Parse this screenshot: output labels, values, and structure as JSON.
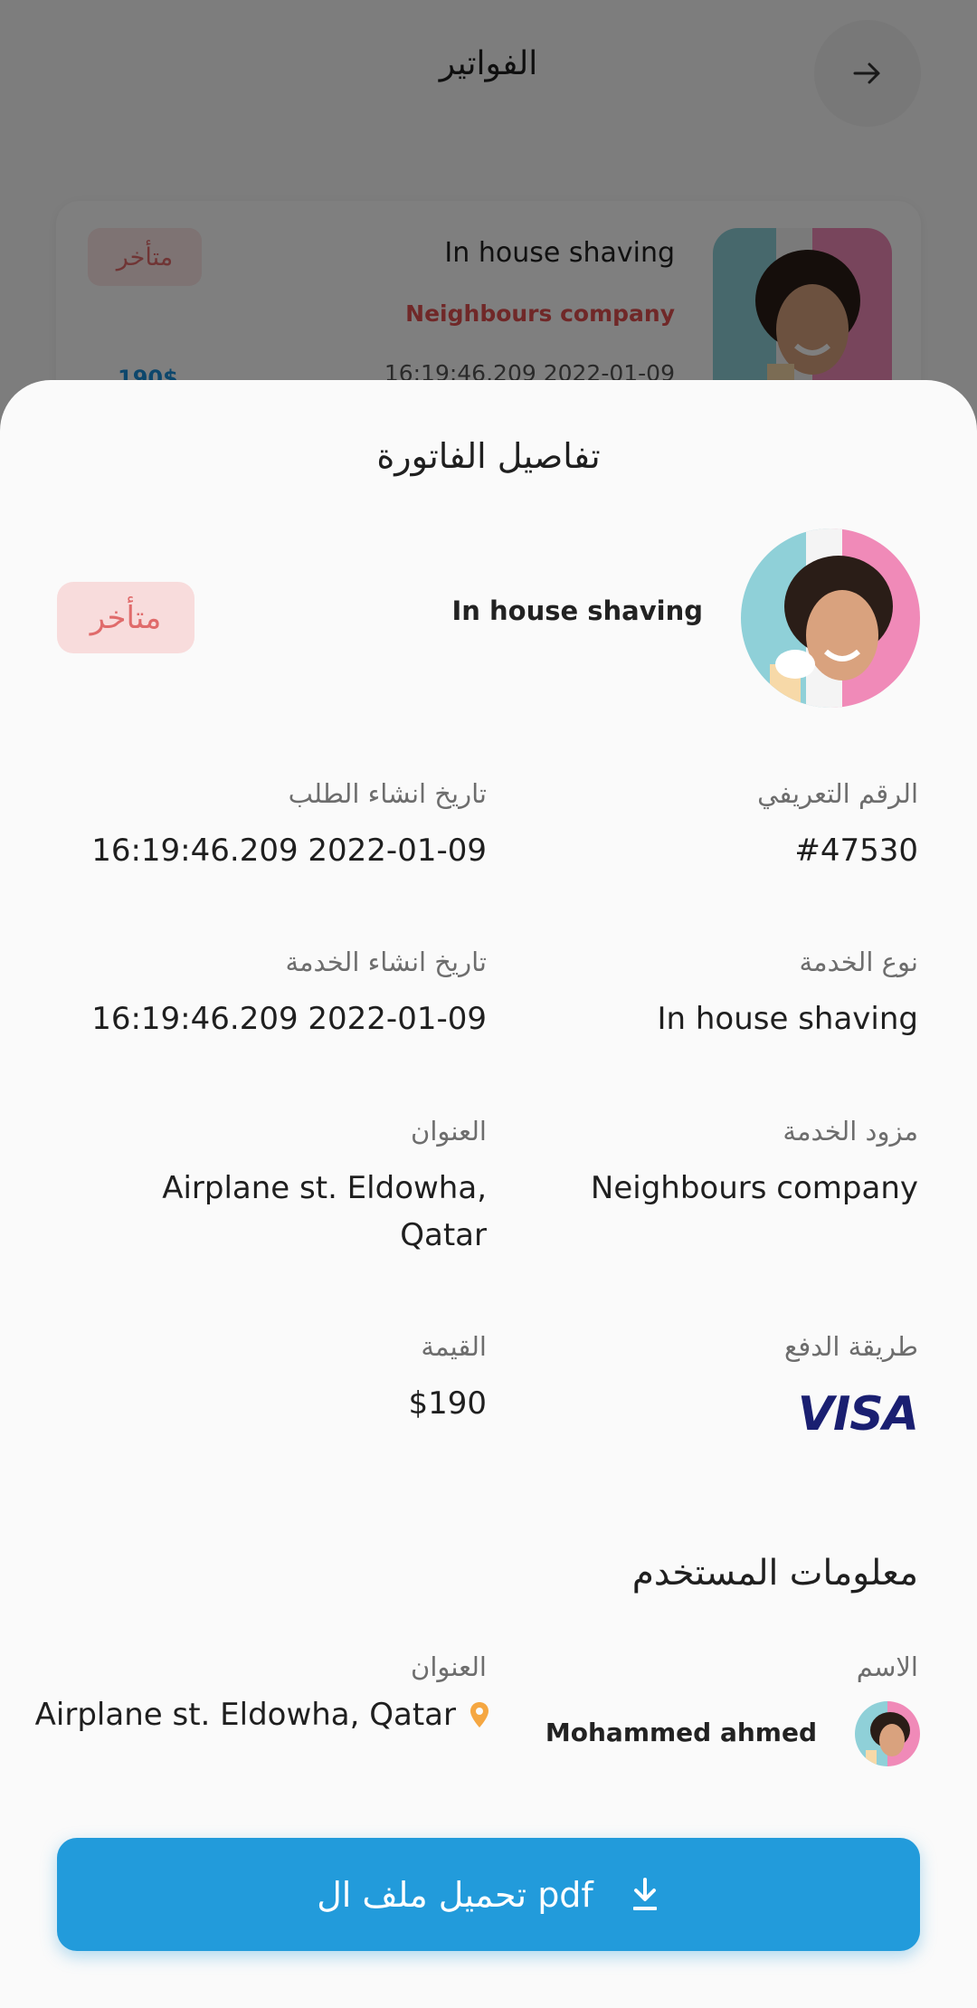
{
  "background": {
    "header_title": "الفواتير",
    "card": {
      "title": "In house shaving",
      "company": "Neighbours company",
      "date": "16:19:46.209 2022-01-09",
      "status": "متأخر",
      "price": "190$"
    }
  },
  "sheet": {
    "title": "تفاصيل الفاتورة",
    "service_name": "In house shaving",
    "status": "متأخر",
    "fields": {
      "id_label": "الرقم التعريفي",
      "id_value": "#47530",
      "request_date_label": "تاريخ انشاء الطلب",
      "request_date_value": "16:19:46.209 2022-01-09",
      "service_type_label": "نوع الخدمة",
      "service_type_value": "In house shaving",
      "service_date_label": "تاريخ انشاء الخدمة",
      "service_date_value": "16:19:46.209 2022-01-09",
      "provider_label": "مزود الخدمة",
      "provider_value": "Neighbours company",
      "address_label": "العنوان",
      "address_value": "Airplane st. Eldowha, Qatar",
      "payment_label": "طريقة الدفع",
      "payment_value": "VISA",
      "amount_label": "القيمة",
      "amount_value": "$190"
    },
    "user_section": {
      "title": "معلومات المستخدم",
      "name_label": "الاسم",
      "name_value": "Mohammed ahmed",
      "address_label": "العنوان",
      "address_value": "Airplane st. Eldowha, Qatar"
    },
    "download_button": "تحميل ملف ال pdf"
  },
  "colors": {
    "accent": "#229bdb",
    "status_bg": "#f8dcdc",
    "status_text": "#e06b6b",
    "visa": "#1a1f71",
    "pin": "#f5a742"
  }
}
